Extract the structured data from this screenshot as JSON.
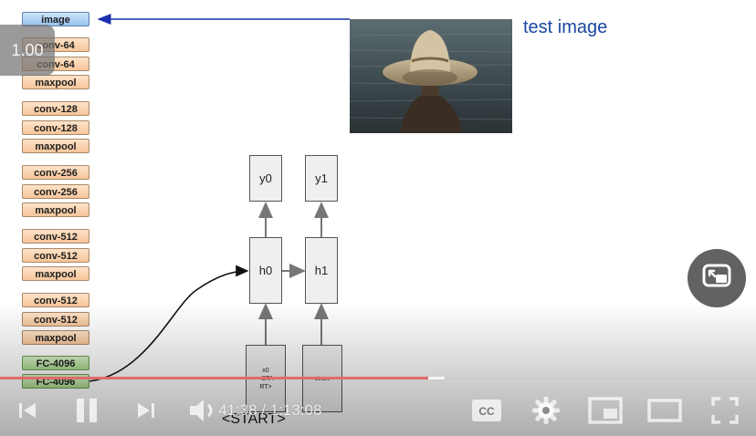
{
  "slide": {
    "layers": [
      {
        "label": "image",
        "kind": "image"
      },
      {
        "label": "conv-64",
        "kind": "conv"
      },
      {
        "label": "conv-64",
        "kind": "conv"
      },
      {
        "label": "maxpool",
        "kind": "conv"
      },
      {
        "label": "conv-128",
        "kind": "conv"
      },
      {
        "label": "conv-128",
        "kind": "conv"
      },
      {
        "label": "maxpool",
        "kind": "conv"
      },
      {
        "label": "conv-256",
        "kind": "conv"
      },
      {
        "label": "conv-256",
        "kind": "conv"
      },
      {
        "label": "maxpool",
        "kind": "conv"
      },
      {
        "label": "conv-512",
        "kind": "conv"
      },
      {
        "label": "conv-512",
        "kind": "conv"
      },
      {
        "label": "maxpool",
        "kind": "conv"
      },
      {
        "label": "conv-512",
        "kind": "conv"
      },
      {
        "label": "conv-512",
        "kind": "conv"
      },
      {
        "label": "maxpool",
        "kind": "conv"
      },
      {
        "label": "FC-4096",
        "kind": "fc"
      },
      {
        "label": "FC-4096",
        "kind": "fc"
      }
    ],
    "test_image_label": "test image",
    "rnn": {
      "y0": "y0",
      "y1": "y1",
      "h0": "h0",
      "h1": "h1",
      "x0": "x0\n<STA\nRT>",
      "x1": "straw",
      "start_label": "<START>"
    },
    "colors": {
      "arrow_blue": "#1c2fb0",
      "title_blue": "#1b48a0",
      "conv_fill": "#f6c59a",
      "fc_fill": "#a8d98c",
      "image_fill": "#98c2ef"
    }
  },
  "player": {
    "speed_badge": "1.00",
    "time_display": "41:38 / 1:13:08",
    "progress_fraction": 0.567,
    "icons": [
      "previous-icon",
      "pause-icon",
      "next-icon",
      "volume-icon",
      "captions-icon",
      "settings-icon",
      "miniplayer-icon",
      "theater-icon",
      "fullscreen-icon",
      "pip-icon"
    ],
    "captions_label": "CC"
  }
}
